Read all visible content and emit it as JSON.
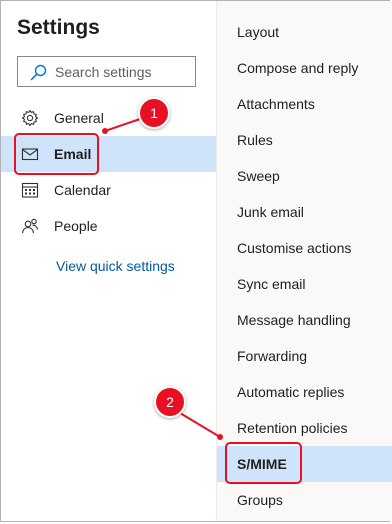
{
  "settings": {
    "title": "Settings",
    "search_placeholder": "Search settings"
  },
  "nav": {
    "items": [
      {
        "label": "General",
        "icon": "gear-icon"
      },
      {
        "label": "Email",
        "icon": "mail-icon",
        "selected": true
      },
      {
        "label": "Calendar",
        "icon": "calendar-icon"
      },
      {
        "label": "People",
        "icon": "people-icon"
      }
    ],
    "quick_settings": "View quick settings"
  },
  "email_settings": {
    "items": [
      "Layout",
      "Compose and reply",
      "Attachments",
      "Rules",
      "Sweep",
      "Junk email",
      "Customise actions",
      "Sync email",
      "Message handling",
      "Forwarding",
      "Automatic replies",
      "Retention policies",
      "S/MIME",
      "Groups"
    ],
    "selected": "S/MIME"
  },
  "annotations": {
    "callout_1": "1",
    "callout_2": "2",
    "color": "#e81123"
  }
}
